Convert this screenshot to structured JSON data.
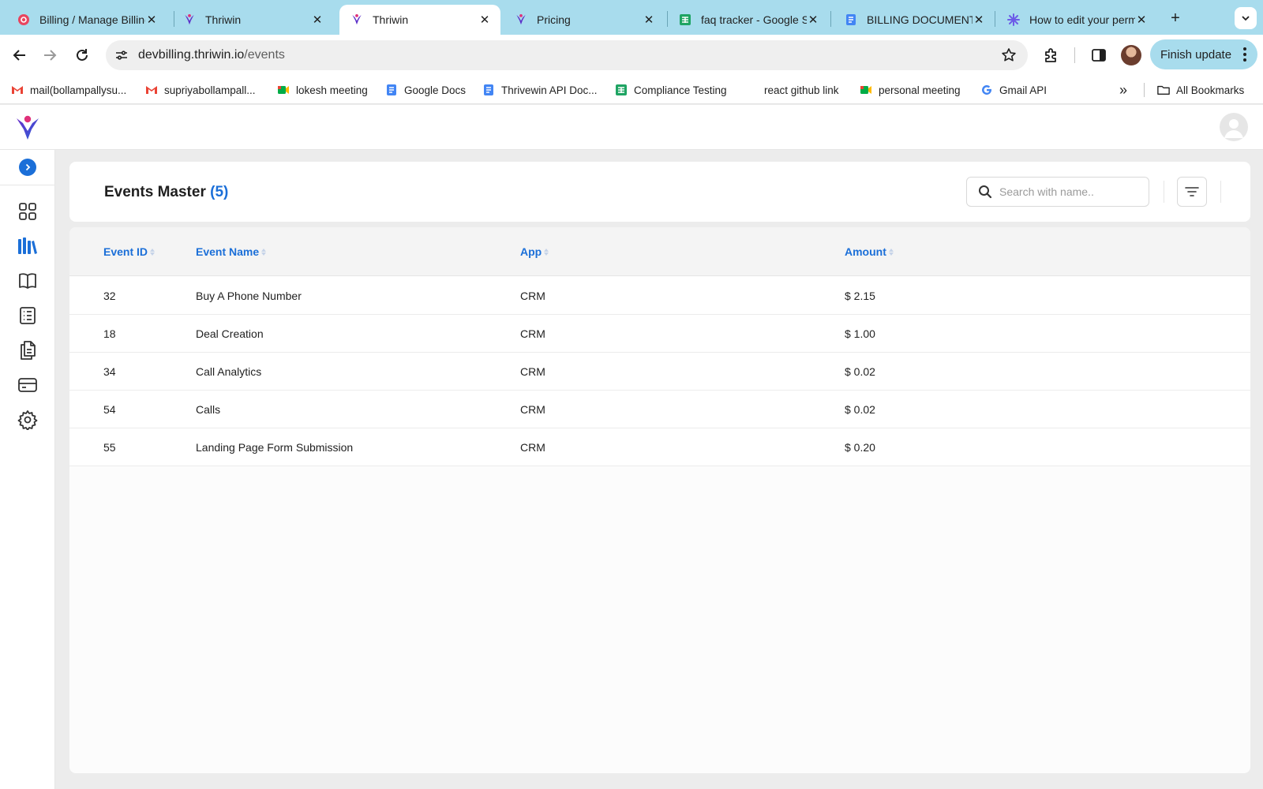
{
  "browser": {
    "tabs": [
      {
        "title": "Billing / Manage Billing",
        "icon": "billing-favicon-icon"
      },
      {
        "title": "Thriwin",
        "icon": "thriwin-favicon-icon"
      },
      {
        "title": "Thriwin",
        "icon": "thriwin-favicon-icon",
        "active": true
      },
      {
        "title": "Pricing",
        "icon": "thriwin-favicon-icon"
      },
      {
        "title": "faq tracker - Google Sheets",
        "icon": "google-sheets-icon"
      },
      {
        "title": "BILLING DOCUMENT",
        "icon": "google-docs-icon"
      },
      {
        "title": "How to edit your permissions",
        "icon": "help-favicon-icon"
      }
    ],
    "close_glyph": "✕",
    "new_tab_glyph": "+",
    "url": {
      "host": "devbilling.thriwin.io",
      "path": "/events"
    },
    "finish_update_label": "Finish update",
    "bookmarks": [
      {
        "label": "mail(bollampallysu...",
        "icon": "gmail-icon"
      },
      {
        "label": "supriyabollampall...",
        "icon": "gmail-icon"
      },
      {
        "label": "lokesh meeting",
        "icon": "google-meet-icon"
      },
      {
        "label": "Google Docs",
        "icon": "google-docs-icon"
      },
      {
        "label": "Thrivewin API Doc...",
        "icon": "google-docs-icon"
      },
      {
        "label": "Compliance Testing",
        "icon": "google-sheets-icon"
      },
      {
        "label": "react github link",
        "icon": ""
      },
      {
        "label": "personal meeting",
        "icon": "google-meet-icon"
      },
      {
        "label": "Gmail API",
        "icon": "google-icon"
      }
    ],
    "more_bookmarks_glyph": "»",
    "all_bookmarks_label": "All Bookmarks"
  },
  "colors": {
    "accent": "#1b6fd8",
    "tabstrip": "#a8dced",
    "brand_purple": "#6b2fc9",
    "brand_pink": "#e0307a"
  },
  "sidebar": {
    "items": [
      {
        "name": "dashboard-icon",
        "active": false
      },
      {
        "name": "library-icon",
        "active": true
      },
      {
        "name": "book-icon",
        "active": false
      },
      {
        "name": "list-icon",
        "active": false
      },
      {
        "name": "documents-icon",
        "active": false
      },
      {
        "name": "card-icon",
        "active": false
      },
      {
        "name": "settings-icon",
        "active": false
      }
    ]
  },
  "page": {
    "title": "Events Master",
    "count": "(5)",
    "search_placeholder": "Search with name.."
  },
  "table": {
    "columns": [
      "Event ID",
      "Event Name",
      "App",
      "Amount"
    ],
    "rows": [
      {
        "id": "32",
        "name": "Buy A Phone Number",
        "app": "CRM",
        "amount": "$ 2.15"
      },
      {
        "id": "18",
        "name": "Deal Creation",
        "app": "CRM",
        "amount": "$ 1.00"
      },
      {
        "id": "34",
        "name": "Call Analytics",
        "app": "CRM",
        "amount": "$ 0.02"
      },
      {
        "id": "54",
        "name": "Calls",
        "app": "CRM",
        "amount": "$ 0.02"
      },
      {
        "id": "55",
        "name": "Landing Page Form Submission",
        "app": "CRM",
        "amount": "$ 0.20"
      }
    ]
  }
}
